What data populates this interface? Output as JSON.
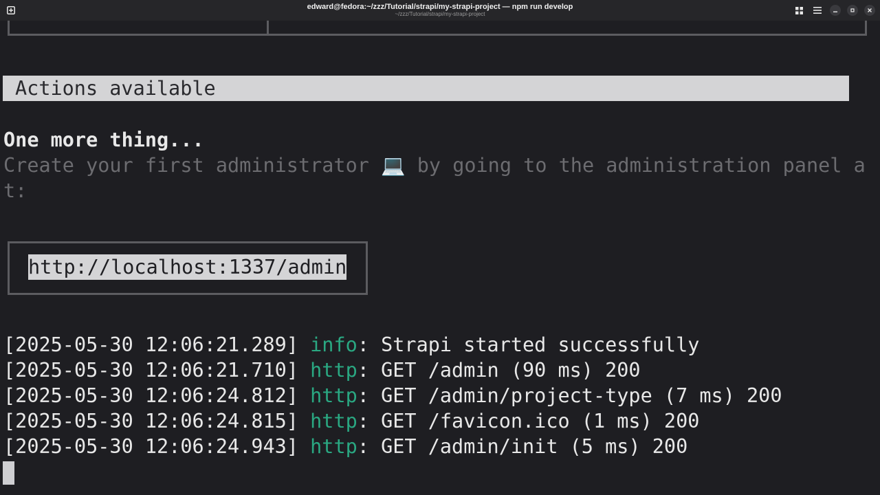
{
  "titlebar": {
    "title": "edward@fedora:~/zzz/Tutorial/strapi/my-strapi-project — npm run develop",
    "subtitle": "~/zzz/Tutorial/strapi/my-strapi-project",
    "new_tab_icon": "plus-square-icon",
    "overview_icon": "grid-icon",
    "menu_icon": "hamburger-menu-icon",
    "minimize_icon": "minimize-icon",
    "maximize_icon": "maximize-icon",
    "close_icon": "close-icon"
  },
  "terminal": {
    "actions_heading": "Actions available",
    "one_more_thing": "One more thing...",
    "create_admin_line1_a": "Create your first administrator ",
    "create_admin_emoji": "💻",
    "create_admin_line1_b": " by going to the administration panel a",
    "create_admin_line2": "t:",
    "admin_url": "http://localhost:1337/admin",
    "logs": [
      {
        "timestamp": "[2025-05-30 12:06:21.289]",
        "level": "info",
        "sep": ": ",
        "message": "Strapi started successfully"
      },
      {
        "timestamp": "[2025-05-30 12:06:21.710]",
        "level": "http",
        "sep": ": ",
        "message": "GET /admin (90 ms) 200"
      },
      {
        "timestamp": "[2025-05-30 12:06:24.812]",
        "level": "http",
        "sep": ": ",
        "message": "GET /admin/project-type (7 ms) 200"
      },
      {
        "timestamp": "[2025-05-30 12:06:24.815]",
        "level": "http",
        "sep": ": ",
        "message": "GET /favicon.ico (1 ms) 200"
      },
      {
        "timestamp": "[2025-05-30 12:06:24.943]",
        "level": "http",
        "sep": ": ",
        "message": "GET /admin/init (5 ms) 200"
      }
    ]
  },
  "colors": {
    "background": "#1e1e22",
    "titlebar": "#262629",
    "log_level": "#2aa882",
    "dim_text": "#6c6c70",
    "highlight": "#d4d4d6"
  }
}
